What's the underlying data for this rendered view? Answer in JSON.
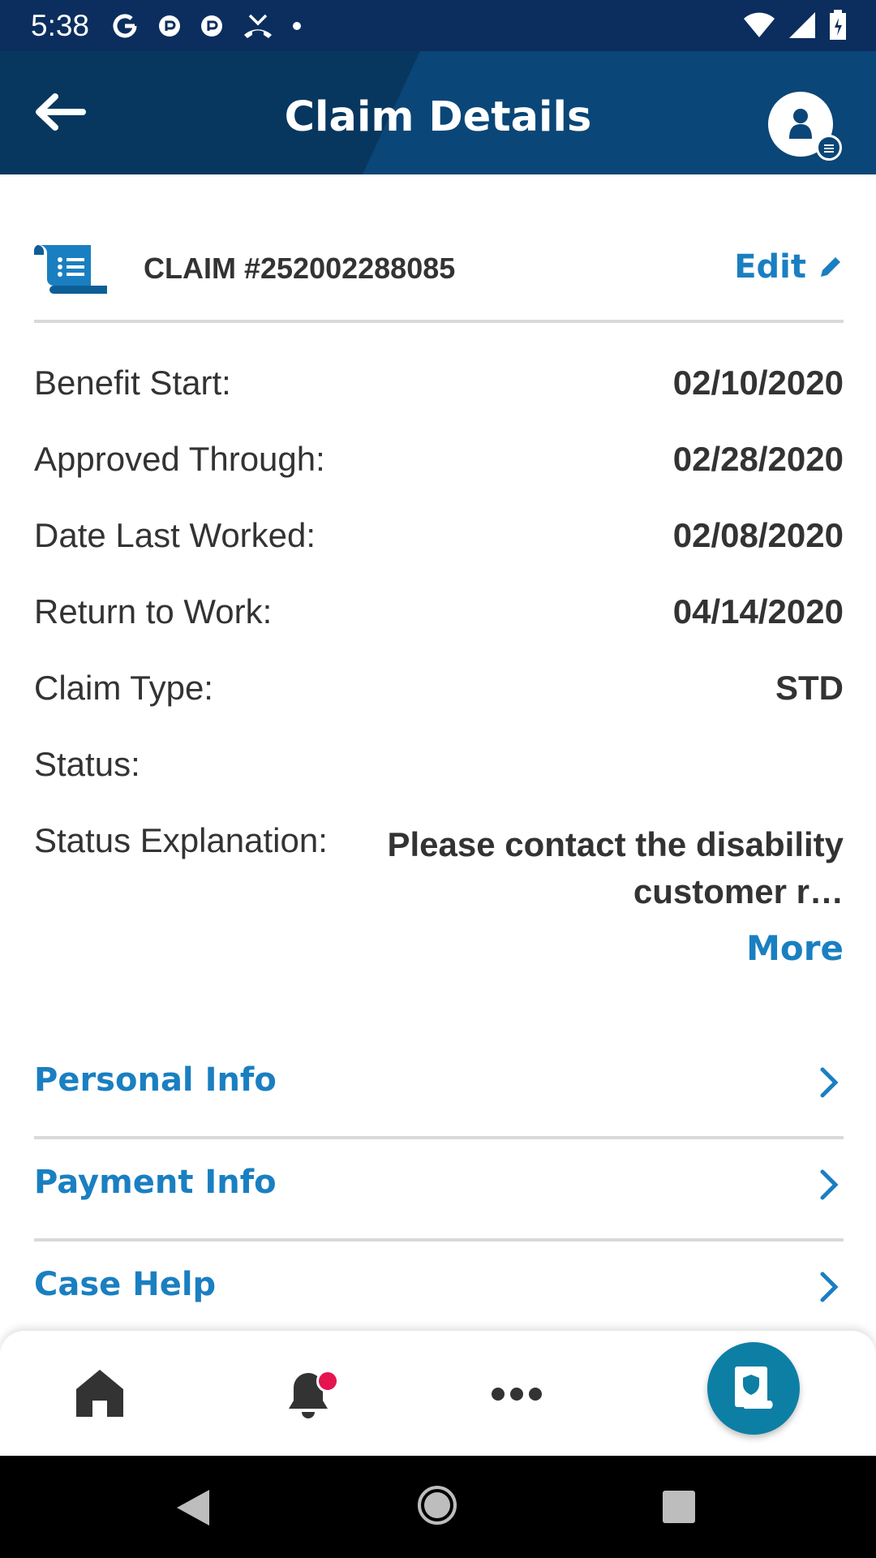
{
  "status_bar": {
    "time": "5:38",
    "left_icons": [
      "google-icon",
      "notification-icon",
      "notification-icon",
      "missed-call-icon",
      "dot-icon"
    ],
    "right_icons": [
      "wifi-icon",
      "signal-icon",
      "battery-icon"
    ]
  },
  "app_bar": {
    "title": "Claim Details",
    "back_icon": "arrow-left-icon",
    "profile_icon": "user-icon",
    "background": "#07375f"
  },
  "claim": {
    "number": "CLAIM #252002288085",
    "edit_label": "Edit",
    "icon": "scroll-list-icon"
  },
  "details": [
    {
      "label": "Benefit Start:",
      "value": "02/10/2020"
    },
    {
      "label": "Approved Through:",
      "value": "02/28/2020"
    },
    {
      "label": "Date Last Worked:",
      "value": "02/08/2020"
    },
    {
      "label": "Return to Work:",
      "value": "04/14/2020"
    },
    {
      "label": "Claim Type:",
      "value": "STD"
    },
    {
      "label": "Status:",
      "value": ""
    }
  ],
  "status_explanation": {
    "label": "Status Explanation:",
    "text": "Please contact the disability customer r…",
    "more_label": "More"
  },
  "nav_links": [
    {
      "label": "Personal Info"
    },
    {
      "label": "Payment Info"
    },
    {
      "label": "Case Help"
    }
  ],
  "bottom_nav": {
    "tabs": [
      "home-icon",
      "bell-icon",
      "more-dots-icon",
      "claim-fab-icon"
    ]
  },
  "colors": {
    "accent": "#1a7fc1",
    "header": "#07375f",
    "fab": "#0d7fa5",
    "badge": "#e4144f"
  }
}
